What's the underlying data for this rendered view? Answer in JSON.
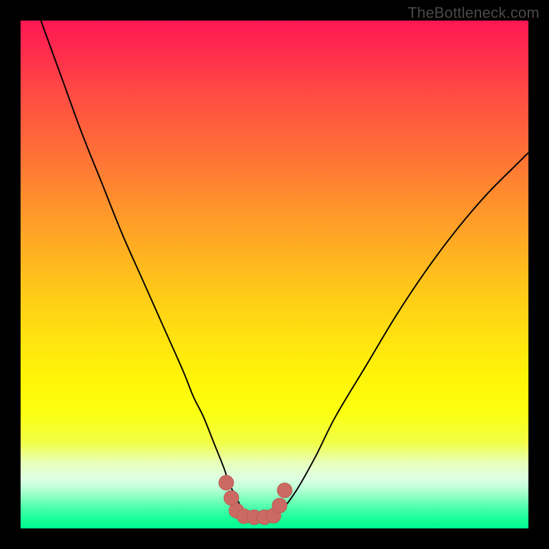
{
  "watermark": "TheBottleneck.com",
  "colors": {
    "curve": "#000000",
    "marker_fill": "#cb6a62",
    "marker_stroke": "#bb5a54"
  },
  "chart_data": {
    "type": "line",
    "title": "",
    "xlabel": "",
    "ylabel": "",
    "xlim": [
      0,
      100
    ],
    "ylim": [
      0,
      100
    ],
    "grid": false,
    "legend": false,
    "series": [
      {
        "name": "bottleneck-curve",
        "x": [
          4,
          8,
          12,
          16,
          20,
          24,
          28,
          32,
          34,
          36,
          38,
          40,
          41,
          42,
          43,
          44,
          45,
          46,
          48,
          50,
          54,
          58,
          62,
          68,
          74,
          80,
          86,
          92,
          98,
          100
        ],
        "y": [
          100,
          89,
          78,
          68,
          58,
          49,
          40,
          31,
          26,
          22,
          17,
          12,
          9,
          7,
          5,
          3,
          2.5,
          2.2,
          2,
          2,
          7,
          14,
          22,
          32,
          42,
          51,
          59,
          66,
          72,
          74
        ]
      }
    ],
    "markers": {
      "name": "valley-markers",
      "points": [
        {
          "x": 40.5,
          "y": 9.0
        },
        {
          "x": 41.5,
          "y": 6.0
        },
        {
          "x": 42.5,
          "y": 3.5
        },
        {
          "x": 44.0,
          "y": 2.4
        },
        {
          "x": 46.0,
          "y": 2.2
        },
        {
          "x": 48.0,
          "y": 2.2
        },
        {
          "x": 49.8,
          "y": 2.5
        },
        {
          "x": 51.0,
          "y": 4.5
        },
        {
          "x": 52.0,
          "y": 7.5
        }
      ],
      "radius_pct": 1.45
    }
  }
}
